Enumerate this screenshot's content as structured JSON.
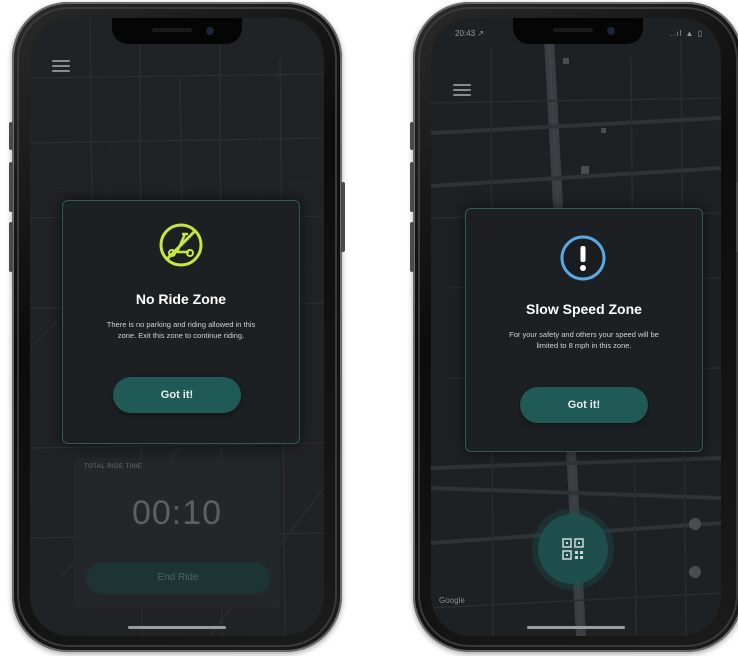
{
  "left_phone": {
    "modal": {
      "title": "No Ride Zone",
      "body": "There is no parking and riding allowed in this zone. Exit this zone to continue riding.",
      "button_label": "Got it!",
      "icon": "no-scooter-icon",
      "icon_color": "#c8e63c"
    },
    "timer": {
      "label": "TOTAL RIDE TIME",
      "value": "00:10",
      "end_ride_label": "End Ride"
    }
  },
  "right_phone": {
    "status_bar": {
      "time": "20:43 ↗",
      "icons": "..ıl ▲ ▯"
    },
    "modal": {
      "title": "Slow Speed Zone",
      "body": "For your safety and others your speed will be limited to 8 mph in this zone.",
      "button_label": "Got it!",
      "icon": "exclamation-icon",
      "icon_color": "#5aa9e6"
    },
    "map_brand": "Google",
    "scan_button_icon": "qr-scan-icon"
  },
  "colors": {
    "background": "#202225",
    "accent": "#1f5a57",
    "modal_border": "#2e5a58"
  }
}
